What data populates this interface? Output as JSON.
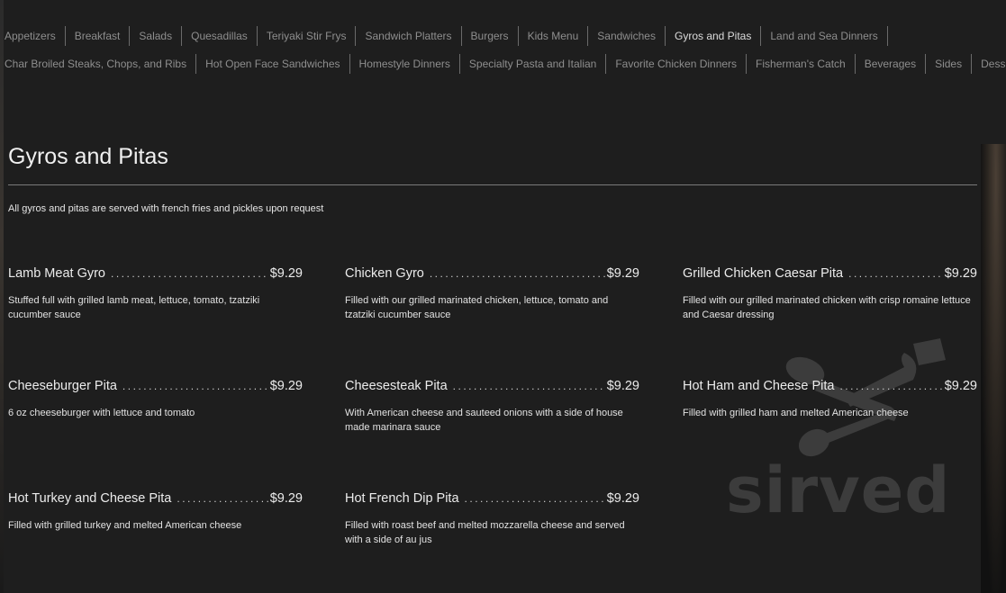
{
  "nav": {
    "row1": [
      {
        "label": "Appetizers",
        "active": false
      },
      {
        "label": "Breakfast",
        "active": false
      },
      {
        "label": "Salads",
        "active": false
      },
      {
        "label": "Quesadillas",
        "active": false
      },
      {
        "label": "Teriyaki Stir Frys",
        "active": false
      },
      {
        "label": "Sandwich Platters",
        "active": false
      },
      {
        "label": "Burgers",
        "active": false
      },
      {
        "label": "Kids Menu",
        "active": false
      },
      {
        "label": "Sandwiches",
        "active": false
      },
      {
        "label": "Gyros and Pitas",
        "active": true
      },
      {
        "label": "Land and Sea Dinners",
        "active": false
      }
    ],
    "row2": [
      {
        "label": "Char Broiled Steaks, Chops, and Ribs",
        "active": false
      },
      {
        "label": "Hot Open Face Sandwiches",
        "active": false
      },
      {
        "label": "Homestyle Dinners",
        "active": false
      },
      {
        "label": "Specialty Pasta and Italian",
        "active": false
      },
      {
        "label": "Favorite Chicken Dinners",
        "active": false
      },
      {
        "label": "Fisherman's Catch",
        "active": false
      },
      {
        "label": "Beverages",
        "active": false
      },
      {
        "label": "Sides",
        "active": false
      },
      {
        "label": "Desserts",
        "active": false
      }
    ]
  },
  "section": {
    "title": "Gyros and Pitas",
    "intro": "All gyros and pitas are served with french fries and pickles upon request"
  },
  "items": [
    {
      "name": "Lamb Meat Gyro",
      "price": "$9.29",
      "description": "Stuffed full with grilled lamb meat, lettuce, tomato, tzatziki cucumber sauce"
    },
    {
      "name": "Chicken Gyro",
      "price": "$9.29",
      "description": "Filled with our grilled marinated chicken, lettuce, tomato and tzatziki cucumber sauce"
    },
    {
      "name": "Grilled Chicken Caesar Pita",
      "price": "$9.29",
      "description": "Filled with our grilled marinated chicken with crisp romaine lettuce and Caesar dressing"
    },
    {
      "name": "Cheeseburger Pita",
      "price": "$9.29",
      "description": "6 oz cheeseburger with lettuce and tomato"
    },
    {
      "name": "Cheesesteak Pita",
      "price": "$9.29",
      "description": "With American cheese and sauteed onions with a side of house made marinara sauce"
    },
    {
      "name": "Hot Ham and Cheese Pita",
      "price": "$9.29",
      "description": "Filled with grilled ham and melted American cheese"
    },
    {
      "name": "Hot Turkey and Cheese Pita",
      "price": "$9.29",
      "description": "Filled with grilled turkey and melted American cheese"
    },
    {
      "name": "Hot French Dip Pita",
      "price": "$9.29",
      "description": "Filled with roast beef and melted mozzarella cheese and served with a side of au jus"
    }
  ],
  "watermark": {
    "text": "sirved",
    "icon": "fork-spoon-icon"
  },
  "colors": {
    "background": "#1e1e1e",
    "nav_text": "#8e8e8e",
    "nav_active": "#dcdcdc",
    "text": "#ececec",
    "watermark": "#555555"
  }
}
